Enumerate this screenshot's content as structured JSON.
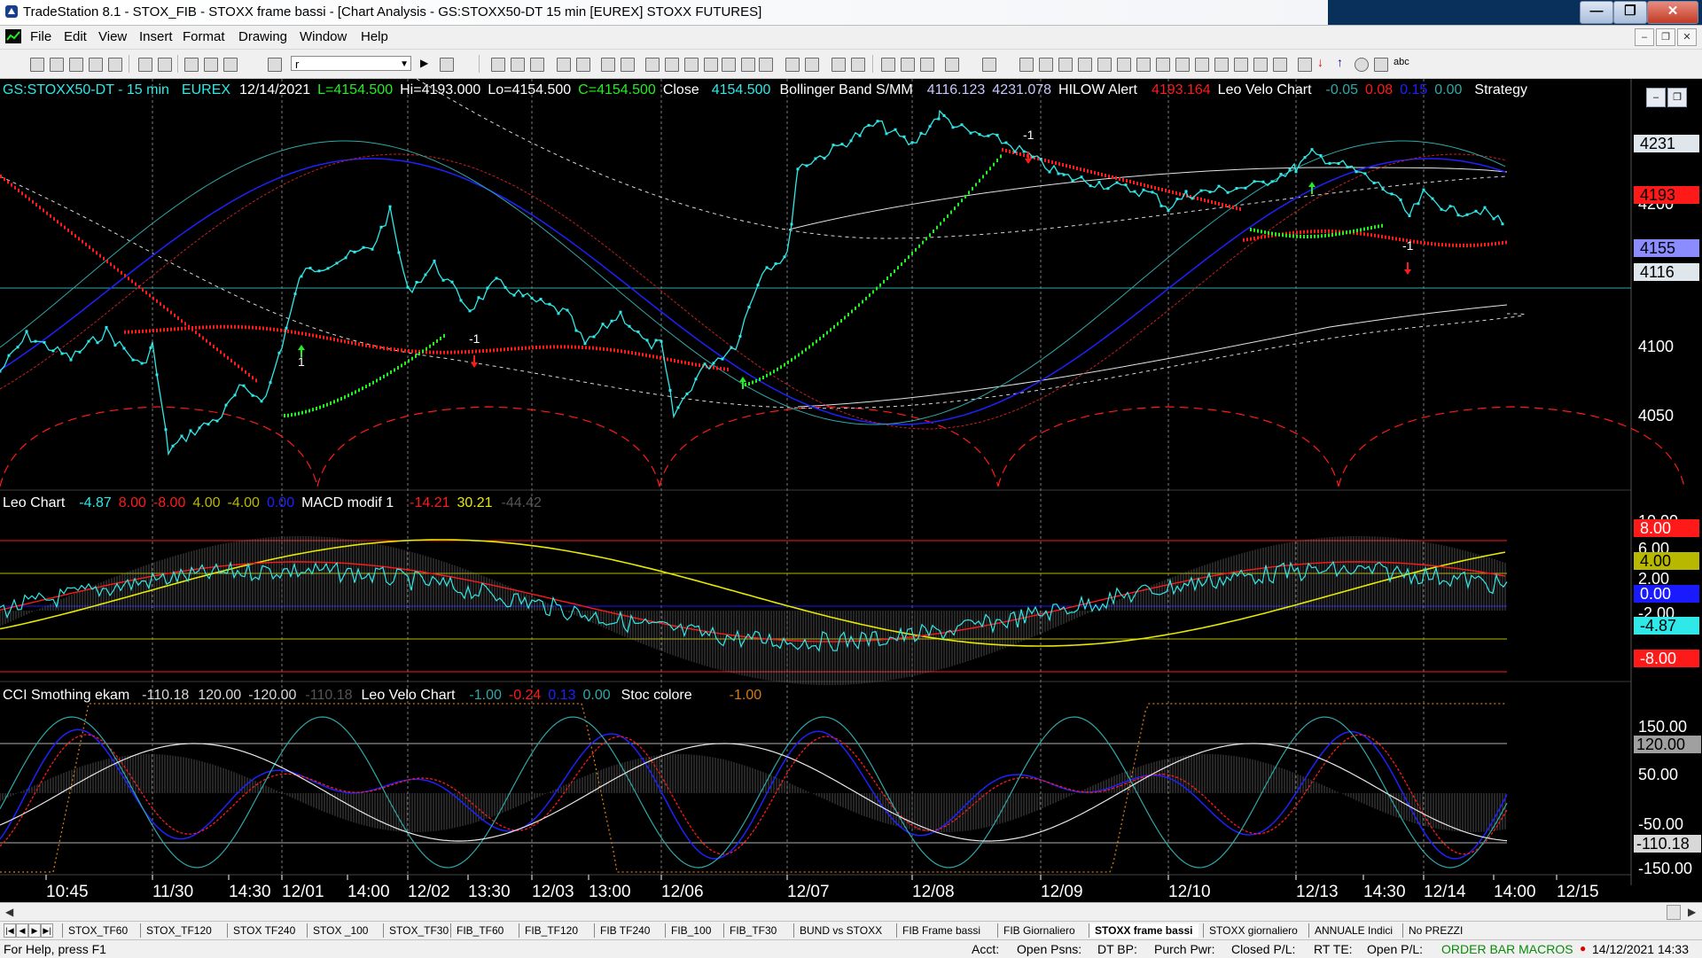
{
  "window": {
    "title": "TradeStation 8.1 - STOX_FIB - STOXX frame bassi - [Chart Analysis - GS:STOXX50-DT  15 min  [EUREX] STOXX FUTURES]",
    "controls": {
      "minimize": "—",
      "maximize": "❐",
      "close": "✕"
    }
  },
  "menu": [
    "File",
    "Edit",
    "View",
    "Insert",
    "Format",
    "Drawing",
    "Window",
    "Help"
  ],
  "mdi_controls": {
    "minimize": "–",
    "restore": "❐",
    "close": "✕"
  },
  "toolbar": {
    "symbol_value": "r"
  },
  "price_pane": {
    "symbol": "GS:STOXX50-DT - 15 min",
    "exchange": "EUREX",
    "date": "12/14/2021",
    "low_last": "L=4154.500",
    "hi": "Hi=4193.000",
    "lo": "Lo=4154.500",
    "close_eq": "C=4154.500",
    "close_label": "Close",
    "close_value": "4154.500",
    "bb_label": "Bollinger Band S/MM",
    "bb_upper": "4116.123",
    "bb_lower": "4231.078",
    "hilow_label": "HILOW Alert",
    "hilow_value": "4193.164",
    "leo_label": "Leo Velo Chart",
    "leo_v1": "-0.05",
    "leo_v2": "0.08",
    "leo_v3": "0.15",
    "leo_v4": "0.00",
    "strategy_label": "Strategy",
    "axis_labels": [
      "4250",
      "4200",
      "4100",
      "4050"
    ],
    "price_boxes": [
      {
        "text": "4231",
        "bg": "#dfe6ec",
        "fg": "#000000"
      },
      {
        "text": "4193",
        "bg": "#ff1a1a",
        "fg": "#000000"
      },
      {
        "text": "4155",
        "bg": "#8a8cff",
        "fg": "#000000"
      },
      {
        "text": "4116",
        "bg": "#dfe6ec",
        "fg": "#000000"
      }
    ],
    "signals": [
      {
        "text": "1",
        "dir": "up"
      },
      {
        "text": "-1",
        "dir": "down"
      },
      {
        "text": "-1",
        "dir": "down"
      },
      {
        "text": "-1",
        "dir": "down"
      }
    ]
  },
  "macd_pane": {
    "leo_label": "Leo Chart",
    "leo_v1": "-4.87",
    "leo_v2": "8.00",
    "leo_v3": "-8.00",
    "leo_v4": "4.00",
    "leo_v5": "-4.00",
    "leo_v6": "0.00",
    "macd_label": "MACD modif 1",
    "macd_v1": "-14.21",
    "macd_v2": "30.21",
    "macd_v3": "-44.42",
    "axis_labels": [
      "10.00",
      "6.00",
      "2.00",
      "-2.00"
    ],
    "value_boxes": [
      {
        "text": "8.00",
        "bg": "#ff1a1a",
        "fg": "#ffffff"
      },
      {
        "text": "4.00",
        "bg": "#b8b800",
        "fg": "#000000"
      },
      {
        "text": "0.00",
        "bg": "#1a1aff",
        "fg": "#ffffff"
      },
      {
        "text": "-4.87",
        "bg": "#2fe8e8",
        "fg": "#000000"
      },
      {
        "text": "-8.00",
        "bg": "#ff1a1a",
        "fg": "#ffffff"
      }
    ]
  },
  "cci_pane": {
    "cci_label": "CCI Smothing ekam",
    "cci_v1": "-110.18",
    "cci_v2": "120.00",
    "cci_v3": "-120.00",
    "cci_v4": "-110.18",
    "leo_label": "Leo Velo Chart",
    "leo_v1": "-1.00",
    "leo_v2": "-0.24",
    "leo_v3": "0.13",
    "leo_v4": "0.00",
    "stoc_label": "Stoc colore",
    "stoc_v1": "-1.00",
    "axis_labels": [
      "150.00",
      "50.00",
      "-50.00",
      "-150.00"
    ],
    "value_boxes": [
      {
        "text": "120.00",
        "bg": "#a0a0a0",
        "fg": "#000000"
      },
      {
        "text": "-110.18",
        "bg": "#d8d8d8",
        "fg": "#000000"
      }
    ]
  },
  "time_axis": [
    "10:45",
    "11/30",
    "14:30",
    "12/01",
    "14:00",
    "12/02",
    "13:30",
    "12/03",
    "13:00",
    "12/06",
    "12/07",
    "12/08",
    "12/09",
    "12/10",
    "12/13",
    "14:30",
    "12/14",
    "14:00",
    "12/15"
  ],
  "tabs": [
    "STOX_TF60",
    "STOX_TF120",
    "STOX TF240",
    "STOX _100",
    "STOX_TF30",
    "FIB_TF60",
    "FIB_TF120",
    "FIB TF240",
    "FIB_100",
    "FIB_TF30",
    "BUND vs STOXX",
    "FIB Frame bassi",
    "FIB Giornaliero",
    "STOXX frame bassi",
    "STOXX giornaliero",
    "ANNUALE Indici",
    "No PREZZI"
  ],
  "active_tab": "STOXX frame bassi",
  "status": {
    "help": "For Help, press F1",
    "acct": "Acct:",
    "open_psns": "Open Psns:",
    "dt_bp": "DT BP:",
    "purch_pwr": "Purch Pwr:",
    "closed_pl": "Closed P/L:",
    "rt_te": "RT TE:",
    "open_pl": "Open P/L:",
    "order_bar": "ORDER BAR  MACROS",
    "datetime": "14/12/2021 14:33"
  },
  "colors": {
    "price": "#2fe8e8",
    "red_line": "#ff1a1a",
    "green_line": "#22ee22",
    "blue": "#2020ff",
    "yellow": "#e8e800",
    "gray_hist": "#8a8a8a",
    "bg": "#000000"
  }
}
